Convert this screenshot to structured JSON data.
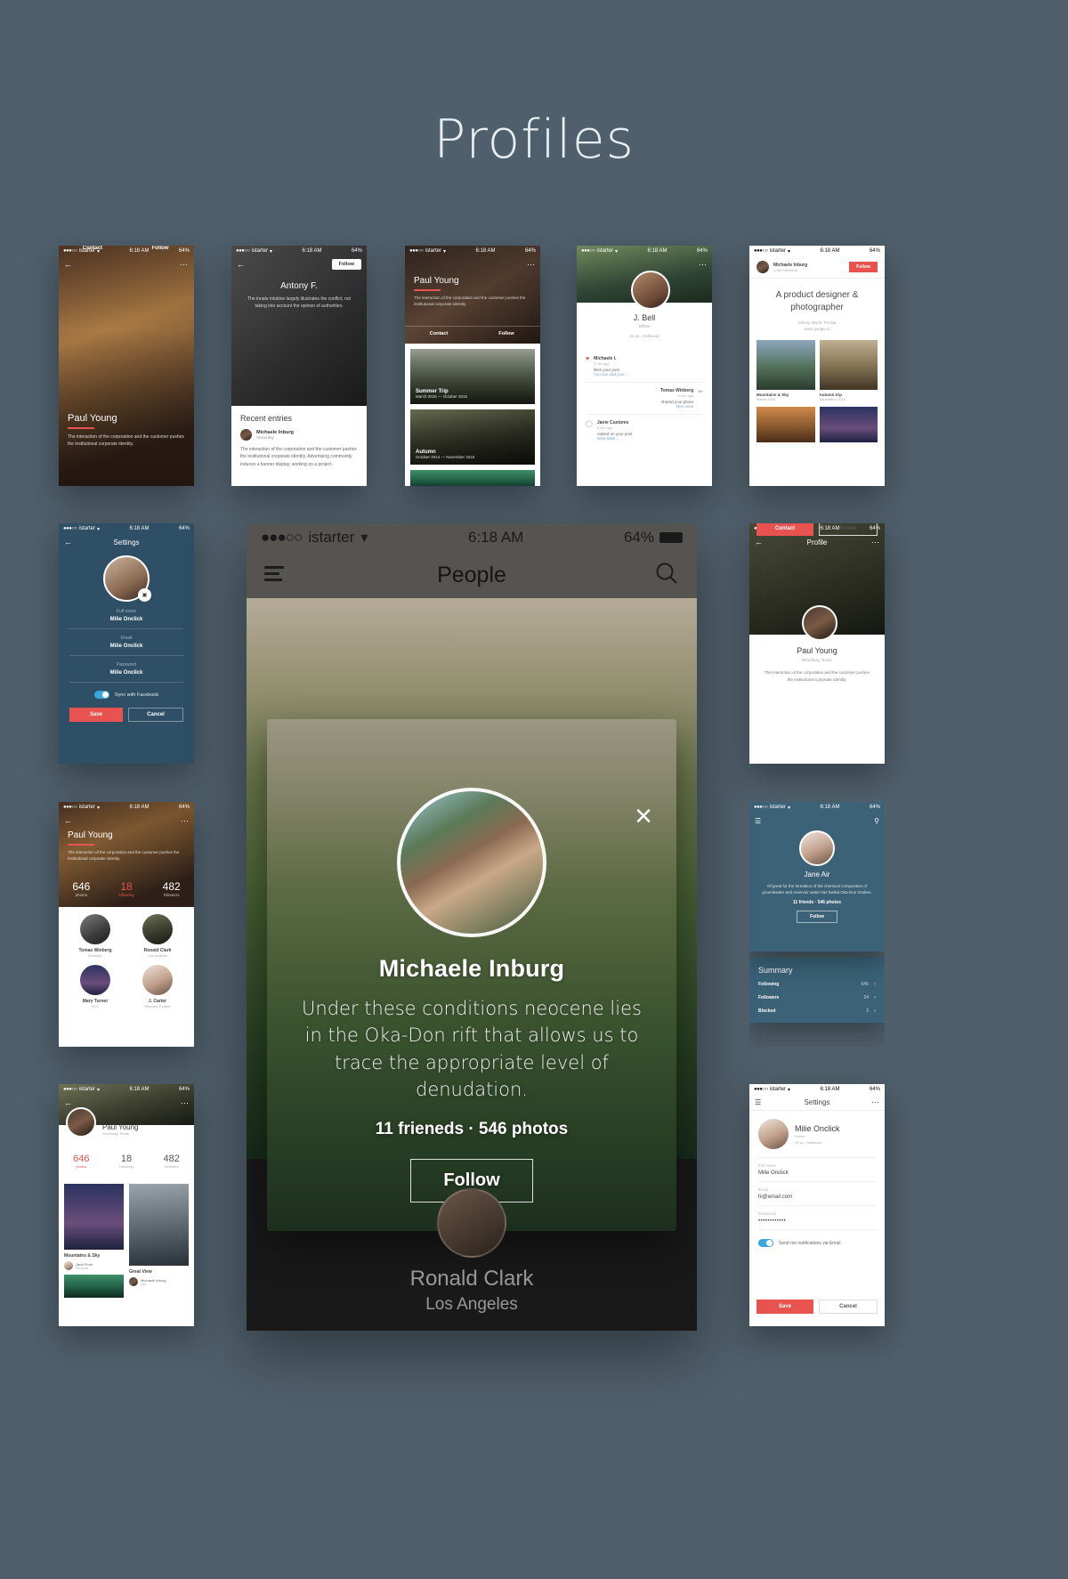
{
  "page": {
    "title": "Profiles",
    "background": "#4f5f6b"
  },
  "colors": {
    "accent_red": "#e8524f",
    "dark_blue": "#2e4f65",
    "toggle_blue": "#3aa6e0"
  },
  "status_bar": {
    "carrier": "istarter",
    "dots": "●●●○○",
    "time": "6:18 AM",
    "battery": "64%"
  },
  "center_phone": {
    "nav_title": "People",
    "menu_icon": "hamburger-icon",
    "search_icon": "search-icon",
    "modal": {
      "close_icon": "close-icon",
      "name": "Michaele Inburg",
      "description": "Under these conditions neocene lies in the Oka-Don rift that allows us to trace the appropriate level of denudation.",
      "stats": "11 frieneds · 546 photos",
      "follow_label": "Follow"
    },
    "bottom_person": {
      "name": "Ronald Clark",
      "city": "Los Angeles"
    }
  },
  "cards": {
    "paul_hero": {
      "name": "Paul Young",
      "bio": "The interaction of the corporation and the customer pushes the institutional corporate identity.",
      "contact_label": "Contact",
      "follow_label": "Follow",
      "back_icon": "back-arrow-icon",
      "more_icon": "more-dots-icon"
    },
    "antony": {
      "name": "Antony F.",
      "bio": "The innate intuition largely illustrates the conflict, not taking into account the opinion of authorities.",
      "follow_label": "Follow",
      "section_title": "Recent entries",
      "entry_author": "Michaele Inburg",
      "entry_time": "Yesterday",
      "entry_body": "The interaction of the corporation and the customer pushes the institutional corporate identity. Advertising community induces a banner display, working on a project.",
      "back_icon": "back-arrow-icon"
    },
    "paul_albums": {
      "name": "Paul Young",
      "bio": "The interaction of the corporation and the customer pushes the institutional corporate identity.",
      "contact_label": "Contact",
      "follow_label": "Follow",
      "albums": [
        {
          "title": "Summer Trip",
          "dates": "March 2015 — October 2015"
        },
        {
          "title": "Autumn",
          "dates": "October 2014 — November 2015"
        }
      ],
      "more_icon": "more-dots-icon"
    },
    "jbell": {
      "name": "J. Bell",
      "status": "Offline",
      "meta": "24 yo., Hollwood",
      "feed": [
        {
          "author": "Michaele I.",
          "time": "5 min ago",
          "action": "likes your post",
          "extra": "You can add your ...",
          "icon": "heart-icon"
        },
        {
          "author": "Tomas Winberg",
          "time": "5 min ago",
          "action": "shared your photo",
          "extra": "Nice view",
          "icon": "share-icon"
        },
        {
          "author": "Janie Customs",
          "time": "5 min ago",
          "action": "replied on your post",
          "extra": "Dear Mike ...",
          "icon": "comment-icon"
        }
      ],
      "more_icon": "more-dots-icon"
    },
    "designer": {
      "header_name": "Michaele Inburg",
      "header_followers": "1,984 followers",
      "follow_label": "Follow",
      "headline": "A product designer & photographer",
      "location": "Disney World, Florida",
      "website": "www.google.io",
      "albums": [
        {
          "title": "Mountains & Sky",
          "date": "March 2016"
        },
        {
          "title": "Autumn trip",
          "date": "September 2016"
        }
      ]
    },
    "settings_dark": {
      "title": "Settings",
      "back_icon": "back-arrow-icon",
      "camera_icon": "camera-icon",
      "fields": [
        {
          "label": "Full name",
          "value": "Milie Onclick"
        },
        {
          "label": "Email",
          "value": "Milie Onclick"
        },
        {
          "label": "Password",
          "value": "Milie Onclick"
        }
      ],
      "toggle_label": "Sync with Facebook",
      "toggle_on": true,
      "save_label": "Save",
      "cancel_label": "Cancel"
    },
    "profile_forest": {
      "nav_title": "Profile",
      "name": "Paul Young",
      "city": "Woodway, Texas",
      "bio": "The interaction of the corporation and the customer pushes the institutional corporate identity.",
      "contact_label": "Contact",
      "follow_label": "Follow",
      "back_icon": "back-arrow-icon",
      "more_icon": "more-dots-icon"
    },
    "paul_friends": {
      "name": "Paul Young",
      "bio": "The interaction of the corporation and the customer pushes the institutional corporate identity.",
      "stats": [
        {
          "value": "646",
          "label": "photos"
        },
        {
          "value": "18",
          "label": "following"
        },
        {
          "value": "482",
          "label": "followers"
        }
      ],
      "friends": [
        {
          "name": "Tomas Winberg",
          "city": "Brooklyn"
        },
        {
          "name": "Ronald Clark",
          "city": "Los Angeles"
        },
        {
          "name": "Mary Turner",
          "city": "NYC"
        },
        {
          "name": "J. Carter",
          "city": "Warsaw, Poland"
        }
      ],
      "back_icon": "back-arrow-icon",
      "more_icon": "more-dots-icon"
    },
    "jane_air": {
      "name": "Jane Air",
      "bio": "Of great for the formation of the chemical composition of groundwater and reservoir water has fueled Oka-Don Graben.",
      "counts": "11 friends · 546 photos",
      "follow_label": "Follow",
      "summary_title": "Summary",
      "summary_rows": [
        {
          "label": "Following",
          "value": "646"
        },
        {
          "label": "Followers",
          "value": "24"
        },
        {
          "label": "Blocked",
          "value": "2"
        }
      ],
      "menu_icon": "hamburger-icon",
      "search_icon": "search-icon"
    },
    "paul_gallery": {
      "name": "Paul Young",
      "city": "Woodway, Texas",
      "stats": [
        {
          "value": "646",
          "label": "photos"
        },
        {
          "value": "18",
          "label": "following"
        },
        {
          "value": "482",
          "label": "followers"
        }
      ],
      "albums": [
        {
          "title": "Mountains & Sky",
          "author": "Jane Frost",
          "sub": "Personal"
        },
        {
          "title": "Great View",
          "author": "Michaele Inburg",
          "sub": "City"
        }
      ],
      "back_icon": "back-arrow-icon",
      "more_icon": "more-dots-icon"
    },
    "settings_light": {
      "title": "Settings",
      "name": "Milie Onclick",
      "status": "Online",
      "meta": "24 yo., Holliwood",
      "fields": [
        {
          "label": "Full name",
          "value": "Milie Onclick"
        },
        {
          "label": "Email",
          "value": "hi@email.com"
        },
        {
          "label": "Password",
          "value": "••••••••••••"
        }
      ],
      "toggle_label": "Send me notifications via Email",
      "toggle_on": true,
      "save_label": "Save",
      "cancel_label": "Cancel",
      "menu_icon": "hamburger-icon",
      "more_icon": "more-dots-icon"
    }
  }
}
